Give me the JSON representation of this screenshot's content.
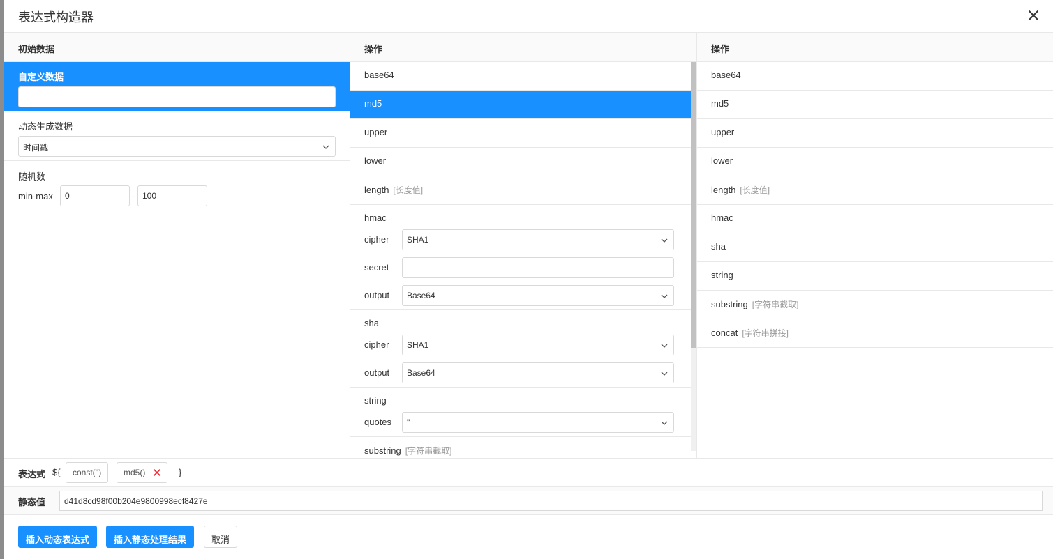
{
  "dialog": {
    "title": "表达式构造器"
  },
  "column1": {
    "header": "初始数据",
    "custom": {
      "label": "自定义数据",
      "value": ""
    },
    "dynamic": {
      "label": "动态生成数据",
      "selected": "时间戳"
    },
    "random": {
      "label": "随机数",
      "range_label": "min-max",
      "min": "0",
      "dash": "-",
      "max": "100"
    }
  },
  "column2": {
    "header": "操作",
    "items": [
      {
        "label": "base64"
      },
      {
        "label": "md5"
      },
      {
        "label": "upper"
      },
      {
        "label": "lower"
      },
      {
        "label": "length",
        "hint": "[长度值]"
      }
    ],
    "hmac": {
      "label": "hmac",
      "cipher_label": "cipher",
      "cipher": "SHA1",
      "secret_label": "secret",
      "secret": "",
      "output_label": "output",
      "output": "Base64"
    },
    "sha": {
      "label": "sha",
      "cipher_label": "cipher",
      "cipher": "SHA1",
      "output_label": "output",
      "output": "Base64"
    },
    "string": {
      "label": "string",
      "quotes_label": "quotes",
      "quotes": "\""
    },
    "substring": {
      "label": "substring",
      "hint": "[字符串截取]"
    }
  },
  "column3": {
    "header": "操作",
    "items": [
      {
        "label": "base64"
      },
      {
        "label": "md5"
      },
      {
        "label": "upper"
      },
      {
        "label": "lower"
      },
      {
        "label": "length",
        "hint": "[长度值]"
      },
      {
        "label": "hmac"
      },
      {
        "label": "sha"
      },
      {
        "label": "string"
      },
      {
        "label": "substring",
        "hint": "[字符串截取]"
      },
      {
        "label": "concat",
        "hint": "[字符串拼接]"
      }
    ]
  },
  "expression": {
    "label": "表达式",
    "open": "${",
    "chips": [
      {
        "text": "const('')"
      },
      {
        "text": "md5()"
      }
    ],
    "close": "}"
  },
  "static_value": {
    "label": "静态值",
    "value": "d41d8cd98f00b204e9800998ecf8427e"
  },
  "footer": {
    "insert_dynamic": "插入动态表达式",
    "insert_static": "插入静态处理结果",
    "cancel": "取消"
  },
  "colors": {
    "primary": "#1890ff",
    "remove": "#f5222d"
  }
}
